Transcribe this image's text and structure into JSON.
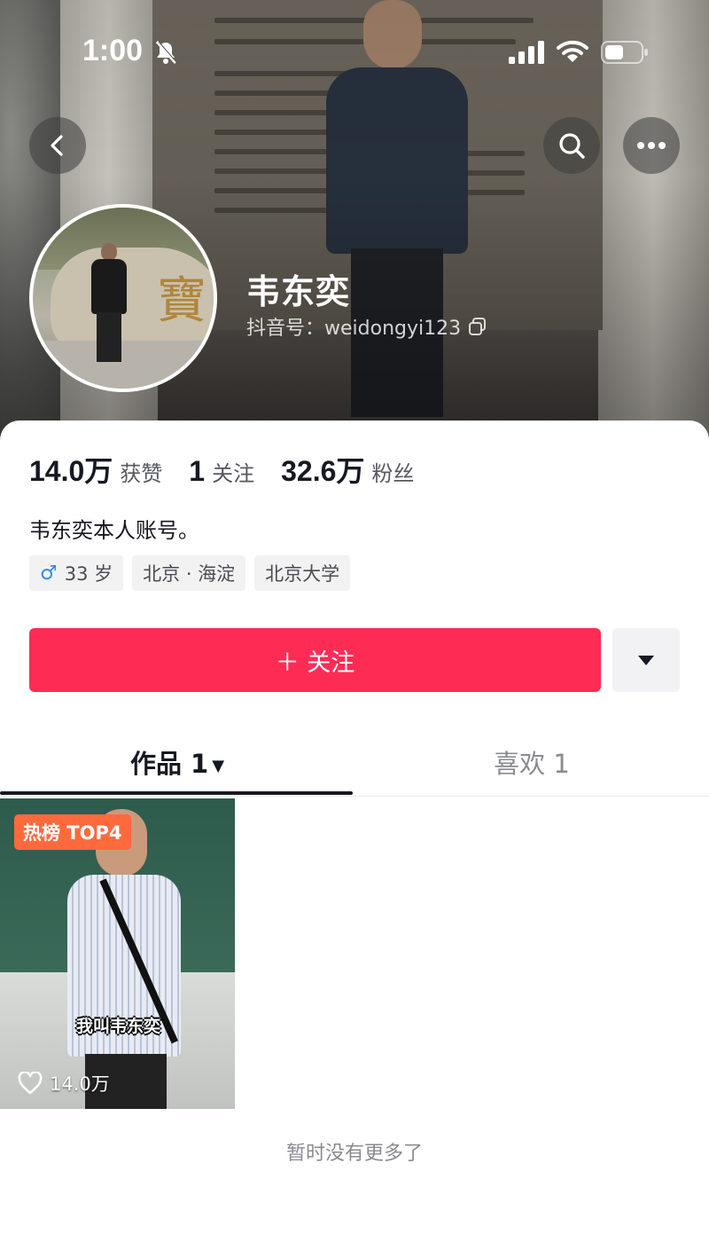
{
  "status_bar": {
    "time": "1:00",
    "icons": [
      "bell-slash-icon",
      "signal-icon",
      "wifi-icon",
      "battery-icon"
    ]
  },
  "nav": {
    "back_icon": "chevron-left-icon",
    "search_icon": "search-icon",
    "more_icon": "more-dots-icon"
  },
  "profile": {
    "name": "韦东奕",
    "douyin_id": "抖音号：weidongyi123",
    "avatar_glyph": "寶"
  },
  "stats": [
    {
      "value": "14.0万",
      "label": "获赞"
    },
    {
      "value": "1",
      "label": "关注"
    },
    {
      "value": "32.6万",
      "label": "粉丝"
    }
  ],
  "bio": "韦东奕本人账号。",
  "tags": {
    "gender_symbol": "♂",
    "age": "33 岁",
    "location": "北京 · 海淀",
    "school": "北京大学"
  },
  "actions": {
    "follow_label": "＋ 关注",
    "dropdown_icon": "triangle-down-icon"
  },
  "tabs": {
    "works": "作品 1",
    "works_caret": "▼",
    "likes": "喜欢 1"
  },
  "videos": [
    {
      "badge": "热榜 TOP4",
      "caption": "我叫韦东奕",
      "likes": "14.0万"
    }
  ],
  "footer": {
    "no_more": "暂时没有更多了"
  },
  "colors": {
    "accent": "#fe2c55",
    "badge": "#ff6a3d",
    "text_primary": "#161823",
    "text_secondary": "#57585f"
  }
}
